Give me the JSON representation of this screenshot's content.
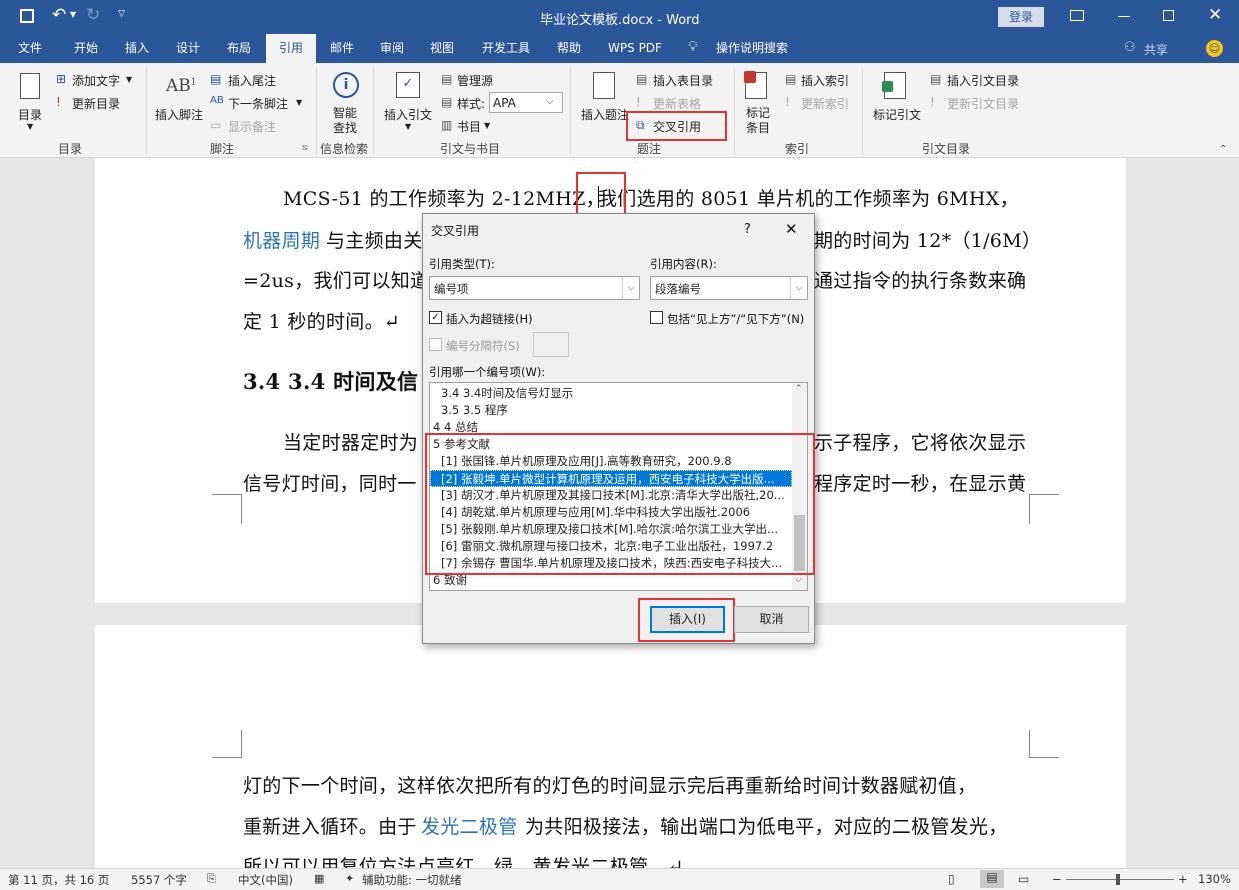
{
  "window": {
    "title": "毕业论文模板.docx - Word",
    "login": "登录",
    "share": "共享",
    "tell_me": "操作说明搜索"
  },
  "tabs": [
    "文件",
    "开始",
    "插入",
    "设计",
    "布局",
    "引用",
    "邮件",
    "审阅",
    "视图",
    "开发工具",
    "帮助",
    "WPS PDF"
  ],
  "ribbon": {
    "toc": "目录",
    "add_text": "添加文字",
    "update_toc": "更新目录",
    "group_toc": "目录",
    "insert_footnote": "插入脚注",
    "insert_endnote": "插入尾注",
    "next_footnote": "下一条脚注",
    "show_notes": "显示备注",
    "group_footnotes": "脚注",
    "smart_lookup_1": "智能",
    "smart_lookup_2": "查找",
    "group_research": "信息检索",
    "insert_citation": "插入引文",
    "manage_sources": "管理源",
    "style_label": "样式:",
    "style_value": "APA",
    "bibliography": "书目",
    "group_citations": "引文与书目",
    "insert_caption": "插入题注",
    "insert_tof": "插入表目录",
    "update_table": "更新表格",
    "cross_reference": "交叉引用",
    "group_captions": "题注",
    "mark_entry_1": "标记",
    "mark_entry_2": "条目",
    "insert_index": "插入索引",
    "update_index": "更新索引",
    "group_index": "索引",
    "mark_citation": "标记引文",
    "insert_toa": "插入引文目录",
    "update_toa": "更新引文目录",
    "group_toa": "引文目录"
  },
  "document": {
    "p1_l1a": "MCS-51 的工作频率为 2-12MHZ，",
    "p1_l1b": "我们选用的 8051 单片机的工作频率为 6MHX，",
    "p1_l2_link": "机器周期",
    "p1_l2a": "与主频由关",
    "p1_l2b": "期的时间为 12*（1/6M）",
    "p1_l3a": "=2us，我们可以知道",
    "p1_l3b": "通过指令的执行条数来确",
    "p1_l4": "定 1 秒的时间。↵",
    "heading": "3.4 3.4 时间及信",
    "p2_l1a": "当定时器定时为",
    "p2_l1b": "示子程序，它将依次显示",
    "p2_l2a": "信号灯时间，同时一",
    "p2_l2b": "程序定时一秒，在显示黄",
    "p3_l1": "灯的下一个时间，这样依次把所有的灯色的时间显示完后再重新给时间计数器赋初值，",
    "p3_l2a": "重新进入循环。由于",
    "p3_l2_link": "发光二极管",
    "p3_l2b": "为共阳极接法，输出端口为低电平，对应的二极管发光，",
    "p3_l3": "所以可以用复位方法点亮红、绿、黄发光二极管。↵"
  },
  "dialog": {
    "title": "交叉引用",
    "help": "?",
    "ref_type_label": "引用类型(T):",
    "ref_type_value": "编号项",
    "ref_content_label": "引用内容(R):",
    "ref_content_value": "段落编号",
    "hyperlink_label": "插入为超链接(H)",
    "above_below_label": "包括“见上方”/“见下方”(N)",
    "separator_label": "编号分隔符(S)",
    "which_label": "引用哪一个编号项(W):",
    "items": [
      "3.4 3.4时间及信号灯显示",
      "3.5 3.5 程序",
      "4 4 总结",
      "5 参考文献",
      "[1] 张国锋.单片机原理及应用[J].高等教育研究，200.9.8",
      "[2] 张毅坤.单片微型计算机原理及运用，西安电子科技大学出版...",
      "[3] 胡汉才.单片机原理及其接口技术[M].北京:清华大学出版社,20...",
      "[4] 胡乾斌.单片机原理与应用[M].华中科技大学出版社.2006",
      "[5] 张毅刚.单片机原理及接口技术[M].哈尔滨:哈尔滨工业大学出...",
      "[6] 雷丽文.微机原理与接口技术，北京:电子工业出版社，1997.2",
      "[7] 余锡存 曹国华.单片机原理及接口技术，陕西:西安电子科技大...",
      "6 致谢"
    ],
    "selected_index": 5,
    "insert_btn": "插入(I)",
    "cancel_btn": "取消"
  },
  "status": {
    "page": "第 11 页，共 16 页",
    "words": "5557 个字",
    "lang": "中文(中国)",
    "accessibility": "辅助功能: 一切就绪",
    "zoom": "130%"
  },
  "colors": {
    "accent": "#2b579a",
    "highlight": "#e0343b",
    "selection": "#0078d7"
  }
}
